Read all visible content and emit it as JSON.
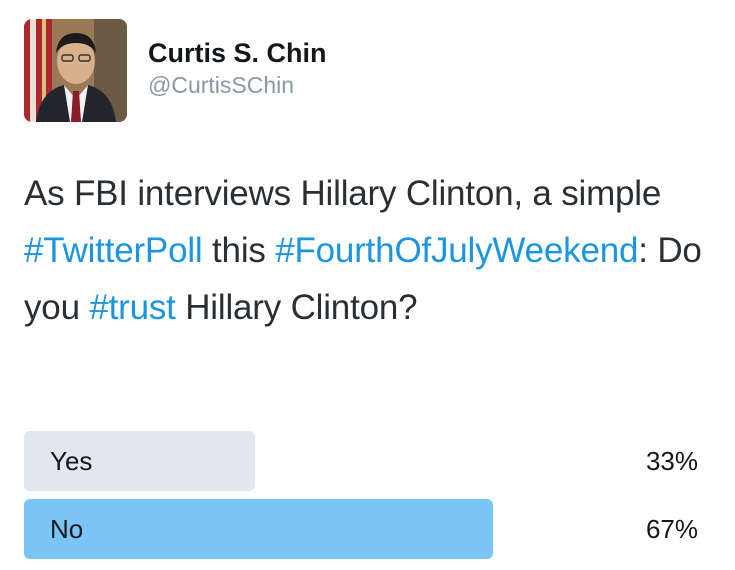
{
  "author": {
    "display_name": "Curtis S. Chin",
    "handle": "@CurtisSChin",
    "avatar_icon": "profile-photo"
  },
  "tweet": {
    "segments": [
      {
        "text": "As FBI interviews Hillary Clinton, a simple ",
        "type": "text"
      },
      {
        "text": "#TwitterPoll",
        "type": "hashtag"
      },
      {
        "text": " this ",
        "type": "text"
      },
      {
        "text": "#FourthOfJulyWeekend",
        "type": "hashtag"
      },
      {
        "text": ": Do you ",
        "type": "text"
      },
      {
        "text": "#trust",
        "type": "hashtag"
      },
      {
        "text": " Hillary Clinton?",
        "type": "text"
      }
    ]
  },
  "poll": {
    "options": [
      {
        "label": "Yes",
        "percent_label": "33%",
        "percent": 33,
        "winner": false
      },
      {
        "label": "No",
        "percent_label": "67%",
        "percent": 67,
        "winner": true
      }
    ]
  },
  "colors": {
    "hashtag": "#1b95e0",
    "poll_bar": "#e1e8ed",
    "poll_bar_winner": "#7ac5f5",
    "handle": "#8899a6"
  }
}
